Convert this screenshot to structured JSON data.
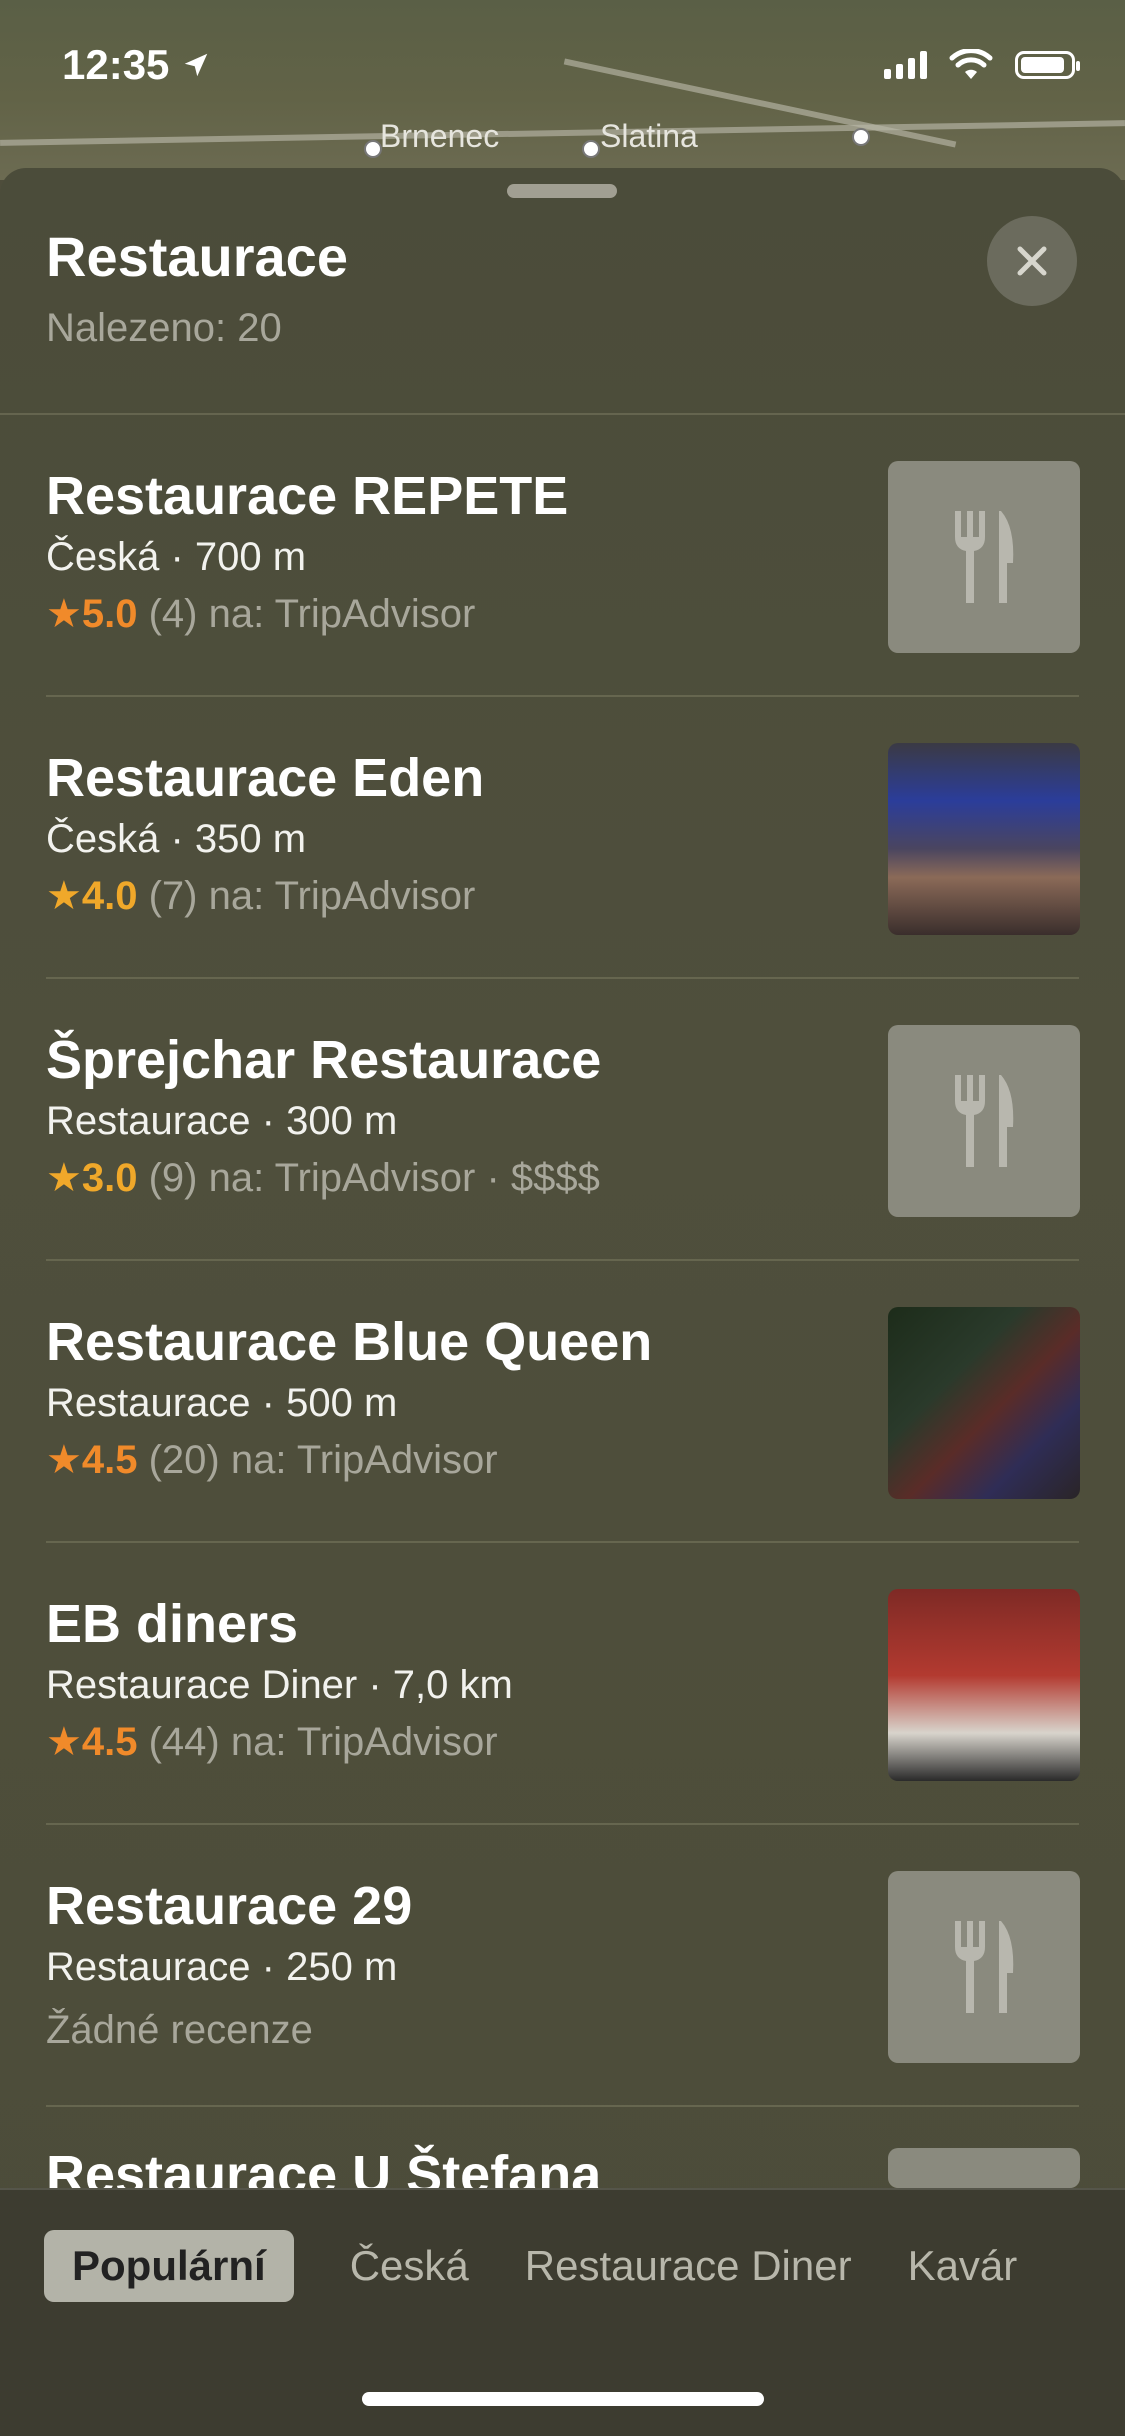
{
  "status_bar": {
    "time": "12:35"
  },
  "map": {
    "towns": [
      "Brnenec",
      "Slatina"
    ]
  },
  "sheet": {
    "title": "Restaurace",
    "subtitle": "Nalezeno: 20"
  },
  "results": [
    {
      "name": "Restaurace REPETE",
      "meta": "Česká · 700 m",
      "star": "★",
      "score": "5.0",
      "rest": " (4) na: TripAdvisor",
      "thumb": "fork-knife"
    },
    {
      "name": "Restaurace Eden",
      "meta": "Česká · 350 m",
      "star": "★",
      "score": "4.0",
      "rest": " (7) na: TripAdvisor",
      "thumb": "photo"
    },
    {
      "name": "Šprejchar Restaurace",
      "meta": "Restaurace · 300 m",
      "star": "★",
      "score": "3.0",
      "rest": " (9) na: TripAdvisor · $$$$",
      "thumb": "fork-knife"
    },
    {
      "name": "Restaurace Blue Queen",
      "meta": "Restaurace · 500 m",
      "star": "★",
      "score": "4.5",
      "rest": " (20) na: TripAdvisor",
      "thumb": "photo"
    },
    {
      "name": "EB diners",
      "meta": "Restaurace Diner · 7,0 km",
      "star": "★",
      "score": "4.5",
      "rest": " (44) na: TripAdvisor",
      "thumb": "photo"
    },
    {
      "name": "Restaurace 29",
      "meta": "Restaurace · 250 m",
      "no_reviews": "Žádné recenze",
      "thumb": "fork-knife"
    }
  ],
  "partial_result": {
    "name": "Restaurace U Štefana"
  },
  "filters": [
    "Populární",
    "Česká",
    "Restaurace Diner",
    "Kavár"
  ],
  "colors": {
    "rating_orange": "#f08a2a",
    "rating_amber": "#f0a82a",
    "sheet_bg": "#4e4d3b"
  }
}
